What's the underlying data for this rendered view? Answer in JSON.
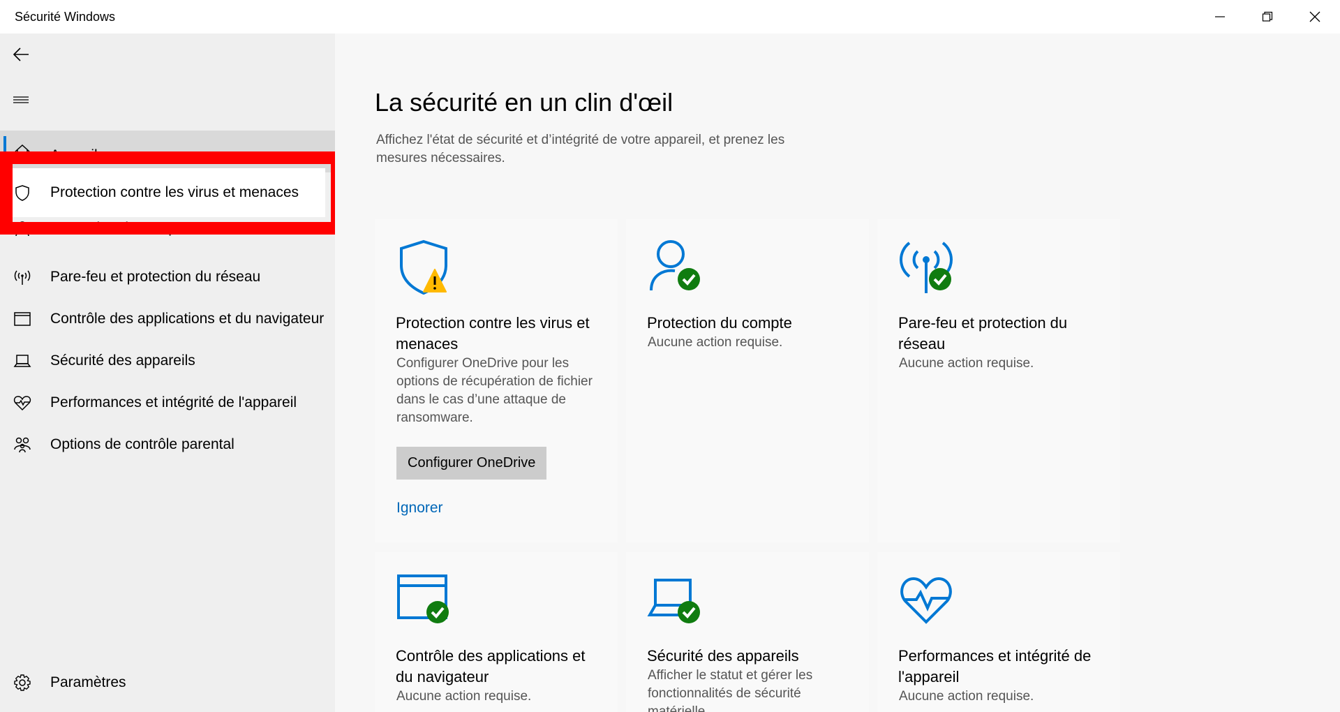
{
  "window": {
    "title": "Sécurité Windows",
    "controls": [
      "minimize-icon",
      "restore-icon",
      "close-icon"
    ]
  },
  "sidebar": {
    "back_icon": "back-arrow-icon",
    "menu_icon": "hamburger-icon",
    "items": [
      {
        "label": "Accueil",
        "icon": "home-icon",
        "active": true
      },
      {
        "label": "Protection contre les virus et menaces",
        "icon": "shield-icon"
      },
      {
        "label": "Protection du compte",
        "icon": "person-icon"
      },
      {
        "label": "Pare-feu et protection du réseau",
        "icon": "wifi-antenna-icon"
      },
      {
        "label": "Contrôle des applications et du navigateur",
        "icon": "browser-window-icon"
      },
      {
        "label": "Sécurité des appareils",
        "icon": "laptop-icon"
      },
      {
        "label": "Performances et intégrité de l'appareil",
        "icon": "heart-pulse-icon"
      },
      {
        "label": "Options de contrôle parental",
        "icon": "family-icon"
      }
    ],
    "settings": {
      "label": "Paramètres",
      "icon": "gear-icon"
    }
  },
  "main": {
    "title": "La sécurité en un clin d'œil",
    "description": "Affichez l'état de sécurité et d’intégrité de votre appareil, et prenez les mesures nécessaires.",
    "cards": [
      {
        "title": "Protection contre les virus et menaces",
        "text": "Configurer OneDrive pour les options de récupération de fichier dans le cas d’une attaque de ransomware.",
        "button": "Configurer OneDrive",
        "link": "Ignorer",
        "status": "warning"
      },
      {
        "title": "Protection du compte",
        "text": "Aucune action requise.",
        "status": "ok"
      },
      {
        "title": "Pare-feu et protection du réseau",
        "text": "Aucune action requise.",
        "status": "ok"
      },
      {
        "title": "Contrôle des applications et du navigateur",
        "text": "Aucune action requise.",
        "status": "ok"
      },
      {
        "title": "Sécurité des appareils",
        "text": "Afficher le statut et gérer les fonctionnalités de sécurité matérielle",
        "status": "ok"
      },
      {
        "title": "Performances et intégrité de l'appareil",
        "text": "Aucune action requise.",
        "status": "none"
      }
    ]
  },
  "colors": {
    "accent": "#0078d4",
    "ok": "#107c10",
    "warning": "#ffb900",
    "highlight": "#ff0000",
    "link": "#0067b8"
  }
}
